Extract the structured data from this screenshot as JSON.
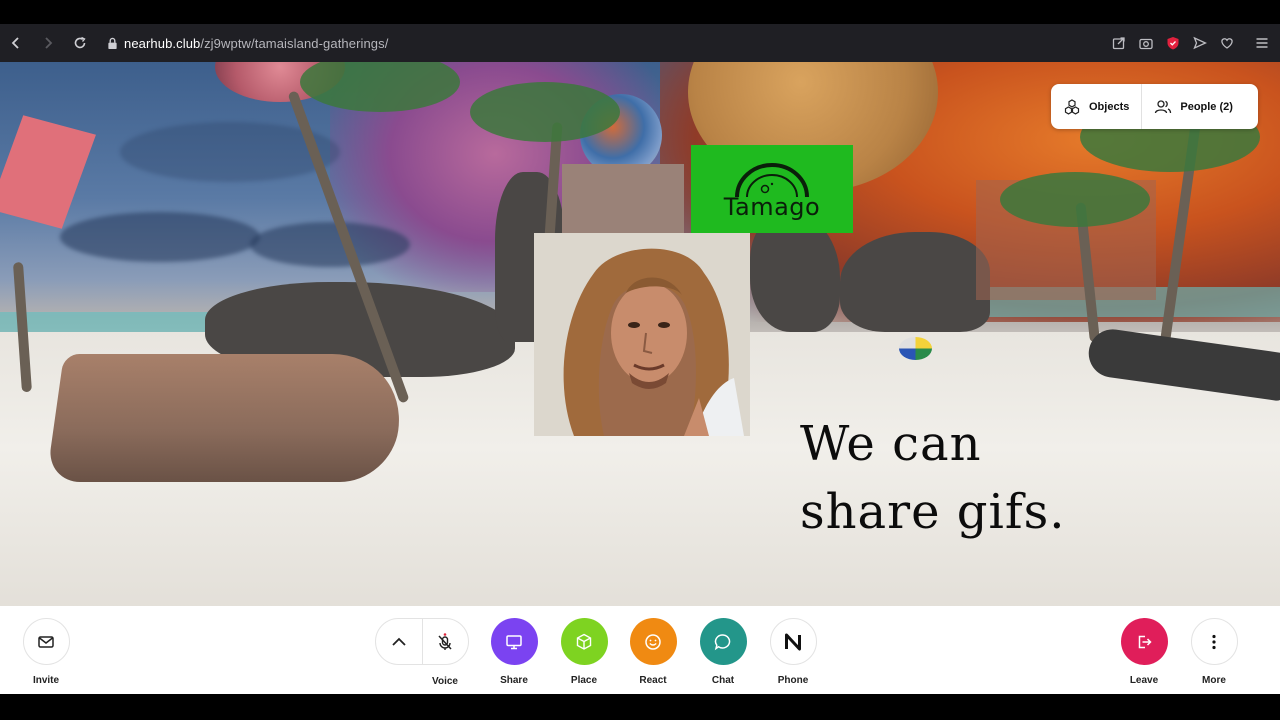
{
  "browser": {
    "url_domain": "nearhub.club",
    "url_path": "/zj9wptw/tamaisland-gatherings/"
  },
  "scene": {
    "logo_text": "Tamago",
    "caption_line1": "We can",
    "caption_line2": "share gifs."
  },
  "hud": {
    "objects_label": "Objects",
    "people_label": "People (2)"
  },
  "toolbar": {
    "invite_label": "Invite",
    "voice_label": "Voice",
    "share_label": "Share",
    "place_label": "Place",
    "react_label": "React",
    "chat_label": "Chat",
    "phone_label": "Phone",
    "leave_label": "Leave",
    "more_label": "More"
  },
  "colors": {
    "share": "#7b43f1",
    "place": "#7ed321",
    "react": "#f08a12",
    "chat": "#23968a",
    "leave": "#e01e5a",
    "logo_bg": "#1fba1f"
  },
  "icons": {
    "back": "chevron-left-icon",
    "forward": "chevron-right-icon",
    "reload": "reload-icon",
    "lock": "lock-icon",
    "objects": "cubes-icon",
    "people": "people-icon",
    "invite": "mail-icon",
    "voice_expand": "chevron-up-icon",
    "voice": "mic-off-icon",
    "share": "monitor-icon",
    "place": "cube-icon",
    "react": "smile-icon",
    "chat": "chat-bubble-icon",
    "phone": "near-logo-icon",
    "leave": "exit-icon",
    "more": "vertical-dots-icon"
  }
}
